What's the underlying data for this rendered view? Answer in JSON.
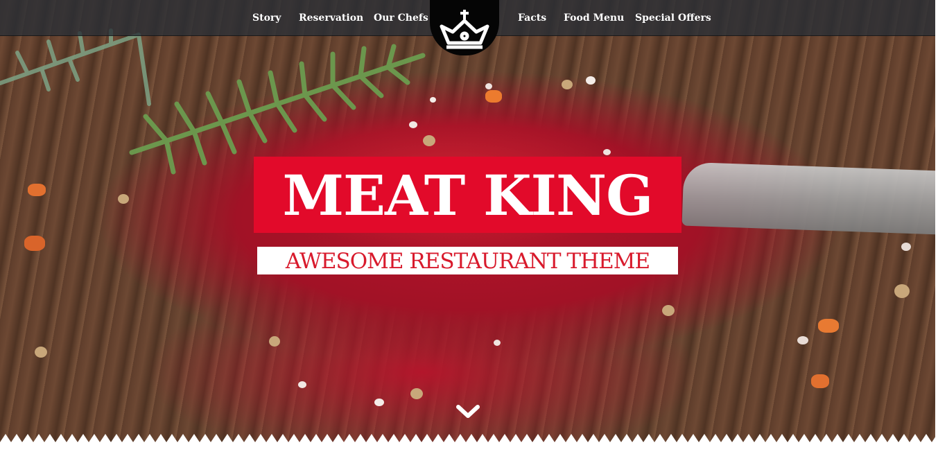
{
  "nav": {
    "left_items": [
      {
        "label": "Story"
      },
      {
        "label": "Reservation"
      },
      {
        "label": "Our Chefs"
      }
    ],
    "right_items": [
      {
        "label": "Facts"
      },
      {
        "label": "Food Menu"
      },
      {
        "label": "Special Offers"
      }
    ],
    "logo_icon": "crown-icon"
  },
  "hero": {
    "title": "MEAT KING",
    "subtitle": "AWESOME RESTAURANT THEME",
    "scroll_icon": "chevron-down-icon"
  },
  "colors": {
    "accent_red": "#e20a2a",
    "subtitle_red": "#d81a2c",
    "nav_bg": "#282e36",
    "logo_bg": "#050505"
  }
}
